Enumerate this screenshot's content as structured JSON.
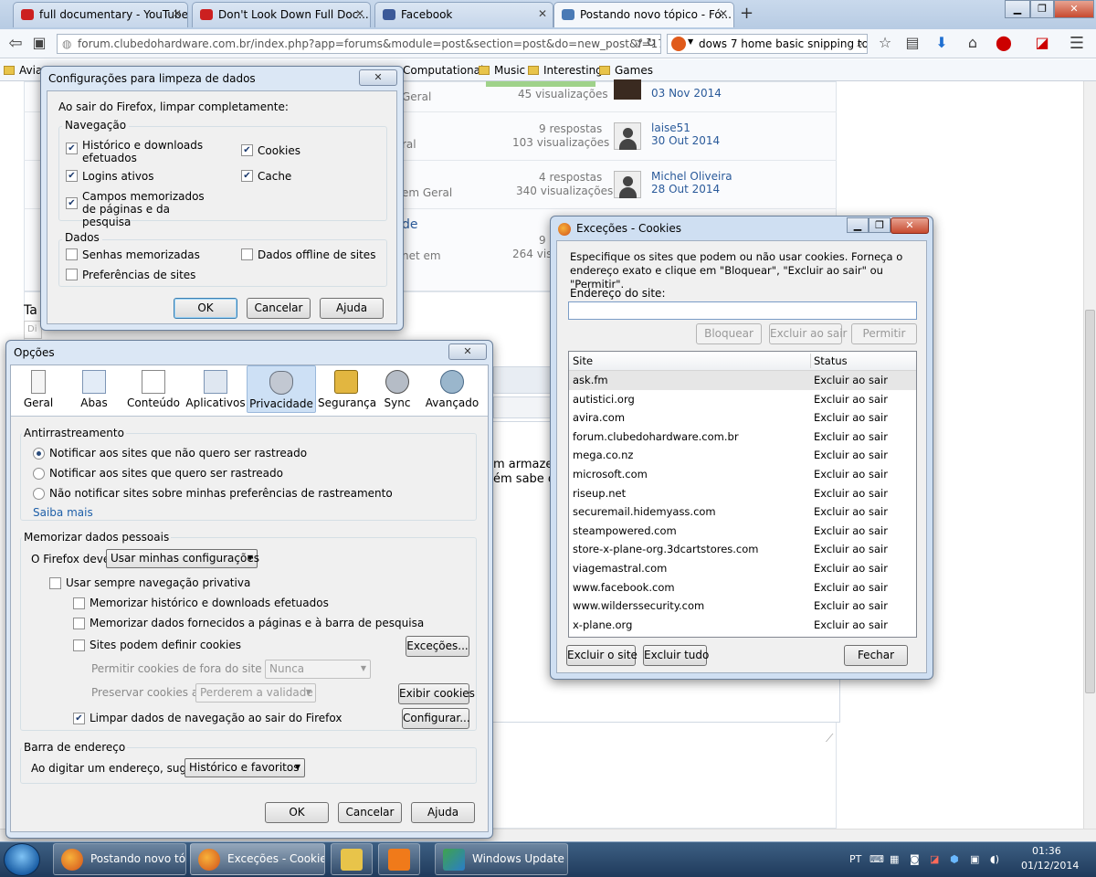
{
  "browser": {
    "tabs": [
      {
        "title": "full documentary - YouTube",
        "color": "#cc2020"
      },
      {
        "title": "Don't Look Down Full Doc...",
        "color": "#cc2020"
      },
      {
        "title": "Facebook",
        "color": "#3b5998"
      },
      {
        "title": "Postando novo tópico - Fó...",
        "color": "#4a7ab5"
      }
    ],
    "url": "forum.clubedohardware.com.br/index.php?app=forums&module=post&section=post&do=new_post&f=170",
    "search_value": "dows 7 home basic snipping tool",
    "bookmarks": [
      "Avia",
      "Computational",
      "Music",
      "Interesting",
      "Games"
    ]
  },
  "page": {
    "rows": [
      {
        "section": "Geral",
        "replies": "",
        "views": "45 visualizações",
        "author": "",
        "date": "03 Nov 2014"
      },
      {
        "section": "ral",
        "replies": "9 respostas",
        "views": "103 visualizações",
        "author": "laise51",
        "date": "30 Out 2014"
      },
      {
        "section": "em Geral",
        "replies": "4 respostas",
        "views": "340 visualizações",
        "author": "Michel Oliveira",
        "date": "28 Out 2014"
      },
      {
        "section": "net em",
        "replies": "9",
        "views": "264 visual",
        "author": "",
        "date": ""
      }
    ],
    "link_fragment": "de",
    "text1": "m armazen",
    "text2": "ém sabe qu",
    "tag_label": "Ta",
    "tag_placeholder": "Di"
  },
  "limpeza_dialog": {
    "title": "Configurações para limpeza de dados",
    "intro": "Ao sair do Firefox, limpar completamente:",
    "nav_group": "Navegação",
    "nav_items": [
      {
        "label": "Histórico e downloads efetuados",
        "checked": true
      },
      {
        "label": "Cookies",
        "checked": true
      },
      {
        "label": "Logins ativos",
        "checked": true
      },
      {
        "label": "Cache",
        "checked": true
      },
      {
        "label": "Campos memorizados de páginas e da pesquisa",
        "checked": true
      }
    ],
    "data_group": "Dados",
    "data_items": [
      {
        "label": "Senhas memorizadas",
        "checked": false
      },
      {
        "label": "Dados offline de sites",
        "checked": false
      },
      {
        "label": "Preferências de sites",
        "checked": false
      }
    ],
    "ok": "OK",
    "cancel": "Cancelar",
    "help": "Ajuda"
  },
  "opcoes_dialog": {
    "title": "Opções",
    "panes": [
      "Geral",
      "Abas",
      "Conteúdo",
      "Aplicativos",
      "Privacidade",
      "Segurança",
      "Sync",
      "Avançado"
    ],
    "selected_pane": "Privacidade",
    "tracking_group": "Antirrastreamento",
    "tracking_options": [
      "Notificar aos sites que não quero ser rastreado",
      "Notificar aos sites que quero ser rastreado",
      "Não notificar sites sobre minhas preferências de rastreamento"
    ],
    "tracking_selected": 0,
    "learn_more": "Saiba mais",
    "history_group": "Memorizar dados pessoais",
    "firefox_will_label": "O Firefox deve:",
    "firefox_will_value": "Usar minhas configurações",
    "private_label": "Usar sempre navegação privativa",
    "remember_history": "Memorizar histórico e downloads efetuados",
    "remember_forms": "Memorizar dados fornecidos a páginas e à barra de pesquisa",
    "accept_cookies": "Sites podem definir cookies",
    "exceptions_btn": "Exceções...",
    "third_party_label": "Permitir cookies de fora do site atual:",
    "third_party_value": "Nunca",
    "keep_until_label": "Preservar cookies até:",
    "keep_until_value": "Perderem a validade",
    "show_cookies_btn": "Exibir cookies",
    "clear_on_close": "Limpar dados de navegação ao sair do Firefox",
    "settings_btn": "Configurar...",
    "location_group": "Barra de endereço",
    "suggest_label": "Ao digitar um endereço, sugerir:",
    "suggest_value": "Histórico e favoritos",
    "ok": "OK",
    "cancel": "Cancelar",
    "help": "Ajuda"
  },
  "excecoes_dialog": {
    "title": "Exceções - Cookies",
    "description": "Especifique os sites que podem ou não usar cookies. Forneça o endereço exato e clique em \"Bloquear\", \"Excluir ao sair\" ou \"Permitir\".",
    "address_label": "Endereço do site:",
    "address_value": "",
    "block_btn": "Bloquear",
    "session_btn": "Excluir ao sair",
    "allow_btn": "Permitir",
    "col_site": "Site",
    "col_status": "Status",
    "sites": [
      {
        "site": "ask.fm",
        "status": "Excluir ao sair"
      },
      {
        "site": "autistici.org",
        "status": "Excluir ao sair"
      },
      {
        "site": "avira.com",
        "status": "Excluir ao sair"
      },
      {
        "site": "forum.clubedohardware.com.br",
        "status": "Excluir ao sair"
      },
      {
        "site": "mega.co.nz",
        "status": "Excluir ao sair"
      },
      {
        "site": "microsoft.com",
        "status": "Excluir ao sair"
      },
      {
        "site": "riseup.net",
        "status": "Excluir ao sair"
      },
      {
        "site": "securemail.hidemyass.com",
        "status": "Excluir ao sair"
      },
      {
        "site": "steampowered.com",
        "status": "Excluir ao sair"
      },
      {
        "site": "store-x-plane-org.3dcartstores.com",
        "status": "Excluir ao sair"
      },
      {
        "site": "viagemastral.com",
        "status": "Excluir ao sair"
      },
      {
        "site": "www.facebook.com",
        "status": "Excluir ao sair"
      },
      {
        "site": "www.wilderssecurity.com",
        "status": "Excluir ao sair"
      },
      {
        "site": "x-plane.org",
        "status": "Excluir ao sair"
      }
    ],
    "remove_btn": "Excluir o site",
    "remove_all_btn": "Excluir tudo",
    "close_btn": "Fechar"
  },
  "taskbar": {
    "items": [
      "Postando novo tó...",
      "Exceções - Cookies",
      "",
      "",
      "Windows Update"
    ],
    "lang": "PT",
    "time": "01:36",
    "date": "01/12/2014"
  }
}
